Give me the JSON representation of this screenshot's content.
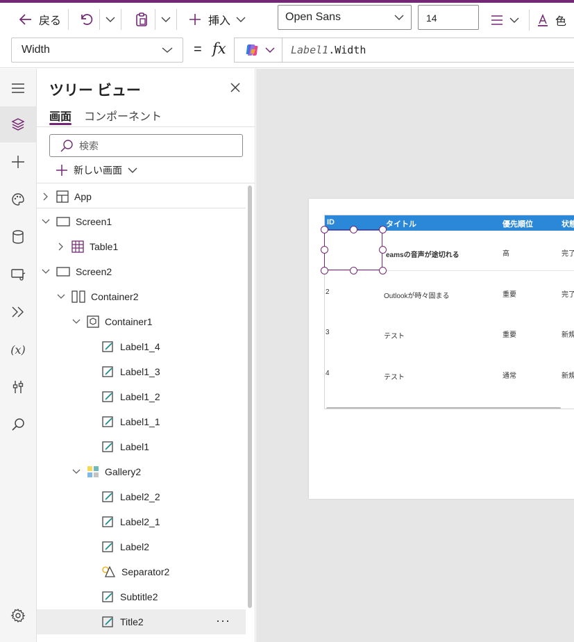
{
  "toolbar": {
    "back_label": "戻る",
    "insert_label": "挿入",
    "font_value": "Open Sans",
    "font_size_value": "14",
    "color_label": "色"
  },
  "formula_bar": {
    "property_value": "Width",
    "equals": "=",
    "fx": "fx",
    "formula_ident": "Label1",
    "formula_rest": ".Width"
  },
  "tree": {
    "title": "ツリー ビュー",
    "tabs": [
      "画面",
      "コンポーネント"
    ],
    "search_placeholder": "検索",
    "new_screen_label": "新しい画面",
    "nodes": [
      {
        "label": "App"
      },
      {
        "label": "Screen1"
      },
      {
        "label": "Table1"
      },
      {
        "label": "Screen2"
      },
      {
        "label": "Container2"
      },
      {
        "label": "Container1"
      },
      {
        "label": "Label1_4"
      },
      {
        "label": "Label1_3"
      },
      {
        "label": "Label1_2"
      },
      {
        "label": "Label1_1"
      },
      {
        "label": "Label1"
      },
      {
        "label": "Gallery2"
      },
      {
        "label": "Label2_2"
      },
      {
        "label": "Label2_1"
      },
      {
        "label": "Label2"
      },
      {
        "label": "Separator2"
      },
      {
        "label": "Subtitle2"
      },
      {
        "label": "Title2",
        "selected": true,
        "more": "···"
      }
    ]
  },
  "table": {
    "headers": [
      "ID",
      "タイトル",
      "優先順位",
      "状態"
    ],
    "rows": [
      {
        "id": "",
        "title": "eamsの音声が途切れる",
        "priority": "高",
        "status": "完了"
      },
      {
        "id": "2",
        "title": "Outlookが時々固まる",
        "priority": "重要",
        "status": "完了"
      },
      {
        "id": "3",
        "title": "テスト",
        "priority": "重要",
        "status": "新規"
      },
      {
        "id": "4",
        "title": "テスト",
        "priority": "通常",
        "status": "新規"
      }
    ]
  },
  "colors": {
    "accent": "#742774",
    "table_header": "#2b88d8",
    "canvas_bg": "#e6e6e6"
  }
}
